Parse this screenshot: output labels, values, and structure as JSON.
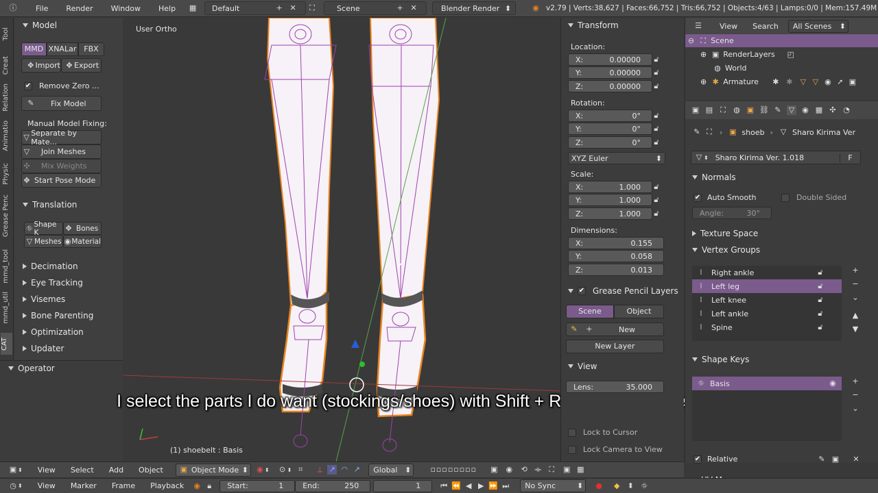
{
  "topbar": {
    "menu": [
      "File",
      "Render",
      "Window",
      "Help"
    ],
    "layout": "Default",
    "scene": "Scene",
    "engine": "Blender Render",
    "stats": "v2.79 | Verts:38,627 | Faces:66,752 | Tris:66,752 | Objects:4/63 | Lamps:0/0 | Mem:157.49M"
  },
  "left_tabs": [
    "Tool",
    "Creat",
    "Relation",
    "Animatio",
    "Physic",
    "Grease Penc",
    "mmd_tool",
    "mmd_util",
    "CAT"
  ],
  "tool": {
    "model_header": "Model",
    "tabs": [
      "MMD",
      "XNALar",
      "FBX"
    ],
    "import": "Import",
    "export": "Export",
    "remove_zero": "Remove Zero ...",
    "fix_model": "Fix Model",
    "manual": "Manual Model Fixing:",
    "separate": "Separate by Mate...",
    "join": "Join Meshes",
    "mix": "Mix Weights",
    "pose": "Start Pose Mode",
    "translation": "Translation",
    "shape_k": "Shape K",
    "bones": "Bones",
    "meshes": "Meshes",
    "material": "Material",
    "collapsed": [
      "Decimation",
      "Eye Tracking",
      "Visemes",
      "Bone Parenting",
      "Optimization",
      "Updater"
    ],
    "operator": "Operator"
  },
  "viewport": {
    "view_label": "User Ortho",
    "object_label": "(1) shoebelt : Basis",
    "subtitle": "I select the parts I do want (stockings/shoes) with Shift + Right Click to select multiple."
  },
  "transform": {
    "header": "Transform",
    "location_label": "Location:",
    "location": [
      {
        "l": "X:",
        "v": "0.00000"
      },
      {
        "l": "Y:",
        "v": "0.00000"
      },
      {
        "l": "Z:",
        "v": "0.00000"
      }
    ],
    "rotation_label": "Rotation:",
    "rotation": [
      {
        "l": "X:",
        "v": "0°"
      },
      {
        "l": "Y:",
        "v": "0°"
      },
      {
        "l": "Z:",
        "v": "0°"
      }
    ],
    "euler": "XYZ Euler",
    "scale_label": "Scale:",
    "scale": [
      {
        "l": "X:",
        "v": "1.000"
      },
      {
        "l": "Y:",
        "v": "1.000"
      },
      {
        "l": "Z:",
        "v": "1.000"
      }
    ],
    "dimensions_label": "Dimensions:",
    "dimensions": [
      {
        "l": "X:",
        "v": "0.155"
      },
      {
        "l": "Y:",
        "v": "0.058"
      },
      {
        "l": "Z:",
        "v": "0.013"
      }
    ],
    "gp_header": "Grease Pencil Layers",
    "gp_scene": "Scene",
    "gp_object": "Object",
    "gp_new": "New",
    "gp_new_layer": "New Layer",
    "view_header": "View",
    "lens_label": "Lens:",
    "lens_value": "35.000",
    "lock_cursor": "Lock to Cursor",
    "lock_camera": "Lock Camera to View"
  },
  "outliner": {
    "view": "View",
    "search": "Search",
    "all_scenes": "All Scenes",
    "items": [
      "Scene",
      "RenderLayers",
      "World",
      "Armature"
    ]
  },
  "props": {
    "breadcrumb_obj": "shoeb",
    "breadcrumb_mesh": "Sharo Kirima Ver",
    "mesh_name": "Sharo Kirima Ver. 1.018",
    "fake": "F",
    "normals": "Normals",
    "auto_smooth": "Auto Smooth",
    "double_sided": "Double Sided",
    "angle": "Angle:",
    "angle_value": "30°",
    "texture_space": "Texture Space",
    "vertex_groups": "Vertex Groups",
    "groups": [
      "Right ankle",
      "Left leg",
      "Left knee",
      "Left ankle",
      "Spine"
    ],
    "shape_keys": "Shape Keys",
    "basis": "Basis",
    "relative": "Relative",
    "uv_maps": "UV Maps"
  },
  "viewheader": {
    "view": "View",
    "select": "Select",
    "add": "Add",
    "object": "Object",
    "mode": "Object Mode",
    "orientation": "Global"
  },
  "timeline": {
    "view": "View",
    "marker": "Marker",
    "frame": "Frame",
    "playback": "Playback",
    "start_label": "Start:",
    "start": "1",
    "end_label": "End:",
    "end": "250",
    "current": "1",
    "sync": "No Sync"
  },
  "colors": {
    "accent": "#7a5b8c",
    "orange": "#e8831f",
    "bg": "#393939"
  }
}
